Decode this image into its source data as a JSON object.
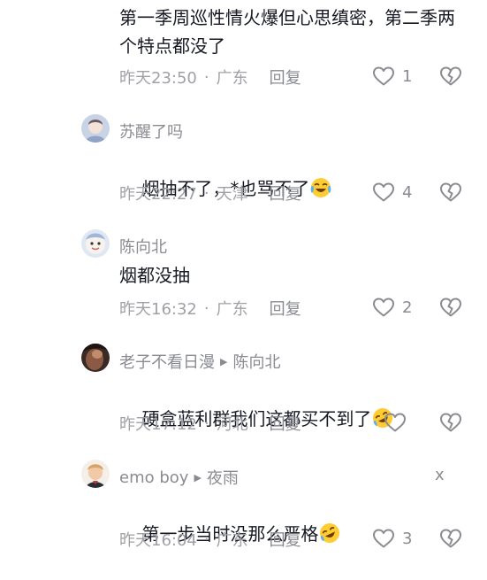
{
  "comments": [
    {
      "username": "",
      "text": "第一季周巡性情火爆但心思缜密，第二季两个特点都没了",
      "time": "昨天23:50",
      "location": "广东",
      "reply_label": "回复",
      "likes": "1"
    },
    {
      "username": "苏醒了吗",
      "text": "烟抽不了，*也骂不了",
      "emoji": "crying-laughing",
      "time": "昨天22:27",
      "location": "天津",
      "reply_label": "回复",
      "likes": "4"
    },
    {
      "username": "陈向北",
      "text": "烟都没抽",
      "time": "昨天16:32",
      "location": "广东",
      "reply_label": "回复",
      "likes": "2"
    },
    {
      "username": "老子不看日漫",
      "reply_to": "陈向北",
      "text": "硬盒蓝利群我们这都买不到了",
      "emoji": "rofl",
      "time": "昨天17:12",
      "location": "河北",
      "reply_label": "回复",
      "likes": ""
    },
    {
      "username": "emo boy",
      "reply_to": "夜雨",
      "close_label": "x",
      "text": "第一步当时没那么严格",
      "emoji": "rofl",
      "time": "昨天16:04",
      "location": "广东",
      "reply_label": "回复",
      "likes": "3"
    }
  ],
  "colors": {
    "text": "#161823",
    "secondary": "#8a8b91",
    "meta": "#a0a1a6",
    "icon": "#8a8b91"
  }
}
